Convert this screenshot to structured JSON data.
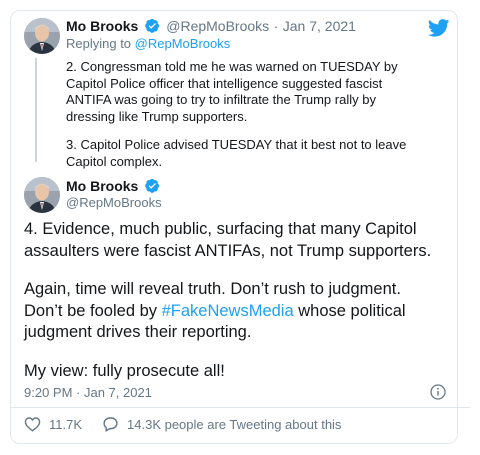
{
  "reply_tweet": {
    "author_name": "Mo Brooks",
    "author_handle": "@RepMoBrooks",
    "separator": "·",
    "date": "Jan 7, 2021",
    "replying_prefix": "Replying to",
    "replying_handle": "@RepMoBrooks",
    "paragraphs": [
      "2. Congressman told me he was warned on TUESDAY by Capitol Police officer that intelligence suggested fascist ANTIFA was going to try to infiltrate the Trump rally by dressing like Trump supporters.",
      "3. Capitol Police advised TUESDAY that it best not to leave Capitol complex."
    ]
  },
  "main_tweet": {
    "author_name": "Mo Brooks",
    "author_handle": "@RepMoBrooks",
    "para1": "4. Evidence, much public, surfacing that many Capitol assaulters were fascist ANTIFAs, not Trump supporters.",
    "para2_line1": "Again, time will reveal truth. Don’t rush to judgment.",
    "para2_pre": "Don’t be fooled by ",
    "hashtag": "#FakeNewsMedia",
    "para2_post": " whose political judgment drives their reporting.",
    "para3": "My view: fully prosecute all!",
    "timestamp": "9:20 PM · Jan 7, 2021"
  },
  "actions": {
    "likes": "11.7K",
    "tweeting_about": "14.3K people are Tweeting about this"
  },
  "colors": {
    "accent": "#1da1f2",
    "muted": "#657786",
    "text": "#14171a",
    "border": "#e1e8ed"
  },
  "icons": [
    "twitter-bird-icon",
    "verified-badge-icon",
    "info-icon",
    "heart-icon",
    "speech-bubble-icon"
  ]
}
